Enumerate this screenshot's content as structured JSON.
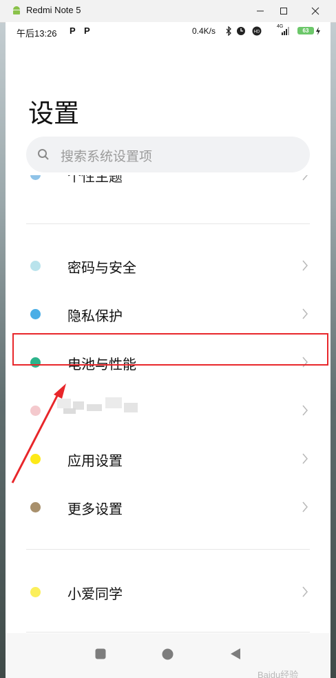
{
  "window": {
    "title": "Redmi Note 5"
  },
  "status_bar": {
    "time": "午后13:26",
    "p1": "P",
    "p2": "P",
    "speed": "0.4K/s",
    "network": "4G",
    "battery": "63"
  },
  "page": {
    "title": "设置"
  },
  "search": {
    "placeholder": "搜索系统设置项"
  },
  "settings": {
    "top_partial": {
      "label": "个性主题",
      "dot_color": "#8fc3e8"
    },
    "items": [
      {
        "label": "密码与安全",
        "dot_color": "#b9e3ec"
      },
      {
        "label": "隐私保护",
        "dot_color": "#4aaee6"
      },
      {
        "label": "电池与性能",
        "dot_color": "#2db38b"
      },
      {
        "label": "",
        "dot_color": "#f4c9cd"
      },
      {
        "label": "应用设置",
        "dot_color": "#fde918"
      },
      {
        "label": "更多设置",
        "dot_color": "#a8906c"
      },
      {
        "label": "小爱同学",
        "dot_color": "#fbef5b"
      }
    ]
  },
  "watermark": "Baidu经验",
  "colors": {
    "annotation": "#e8262a",
    "background": "#ffffff"
  }
}
